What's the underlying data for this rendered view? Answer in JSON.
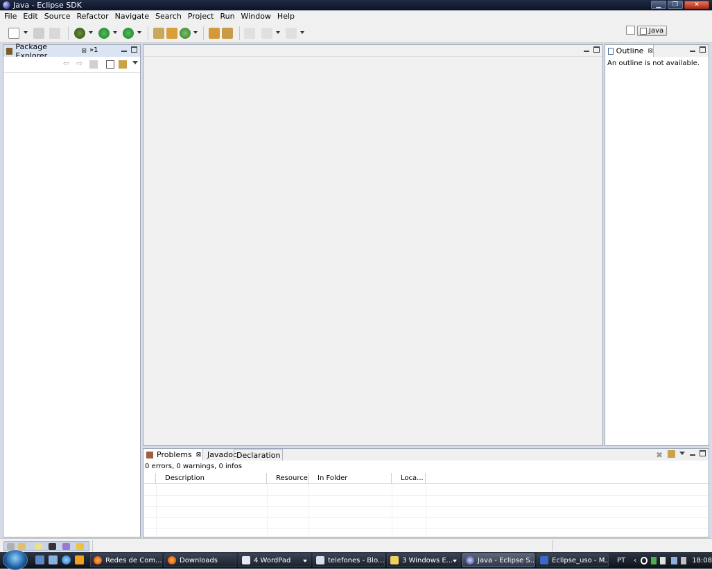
{
  "window": {
    "title": "Java - Eclipse SDK",
    "controls": [
      "▁",
      "❐",
      "✕"
    ]
  },
  "menu": [
    {
      "label": "File"
    },
    {
      "label": "Edit"
    },
    {
      "label": "Source"
    },
    {
      "label": "Refactor"
    },
    {
      "label": "Navigate"
    },
    {
      "label": "Search"
    },
    {
      "label": "Project"
    },
    {
      "label": "Run"
    },
    {
      "label": "Window"
    },
    {
      "label": "Help"
    }
  ],
  "perspective": {
    "label": "Java"
  },
  "package_explorer": {
    "tab_label": "Package Explorer",
    "overflow_label": "»1"
  },
  "outline": {
    "tab_label": "Outline",
    "message": "An outline is not available."
  },
  "problems": {
    "tabs": [
      "Problems",
      "Javadoc",
      "Declaration"
    ],
    "summary": "0 errors, 0 warnings, 0 infos",
    "columns": [
      "Description",
      "Resource",
      "In Folder",
      "Loca..."
    ]
  },
  "taskbar": {
    "tasks": [
      {
        "label": "Redes de Com..."
      },
      {
        "label": "Downloads"
      },
      {
        "label": "4 WordPad"
      },
      {
        "label": "telefones - Blo..."
      },
      {
        "label": "3 Windows E..."
      },
      {
        "label": "Java - Eclipse S..."
      },
      {
        "label": "Eclipse_uso - M..."
      }
    ],
    "language": "PT",
    "clock": "18:08"
  },
  "colors": {
    "taskbar": "#1b212d",
    "view_border": "#9ba6b8",
    "active_tab": "#dbe4f2"
  }
}
